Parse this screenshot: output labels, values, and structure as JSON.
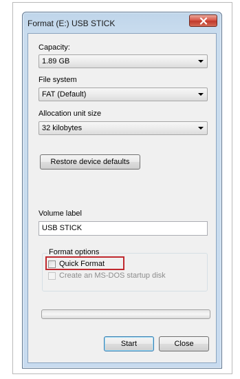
{
  "dialog": {
    "title": "Format (E:) USB STICK",
    "close_icon": "close-x-icon"
  },
  "capacity": {
    "label": "Capacity:",
    "value": "1.89 GB"
  },
  "file_system": {
    "label": "File system",
    "value": "FAT (Default)"
  },
  "allocation": {
    "label": "Allocation unit size",
    "value": "32 kilobytes"
  },
  "restore_button": "Restore device defaults",
  "volume": {
    "label": "Volume label",
    "value": "USB STICK"
  },
  "format_options": {
    "title": "Format options",
    "quick_format": {
      "label": "Quick Format",
      "checked": false
    },
    "msdos_startup": {
      "label": "Create an MS-DOS startup disk",
      "checked": false,
      "disabled": true
    }
  },
  "progress": {
    "value": 0
  },
  "buttons": {
    "start": "Start",
    "close": "Close"
  },
  "colors": {
    "highlight": "#c0282e",
    "close_button": "#c0392b",
    "window_frame": "#c8dbef"
  }
}
